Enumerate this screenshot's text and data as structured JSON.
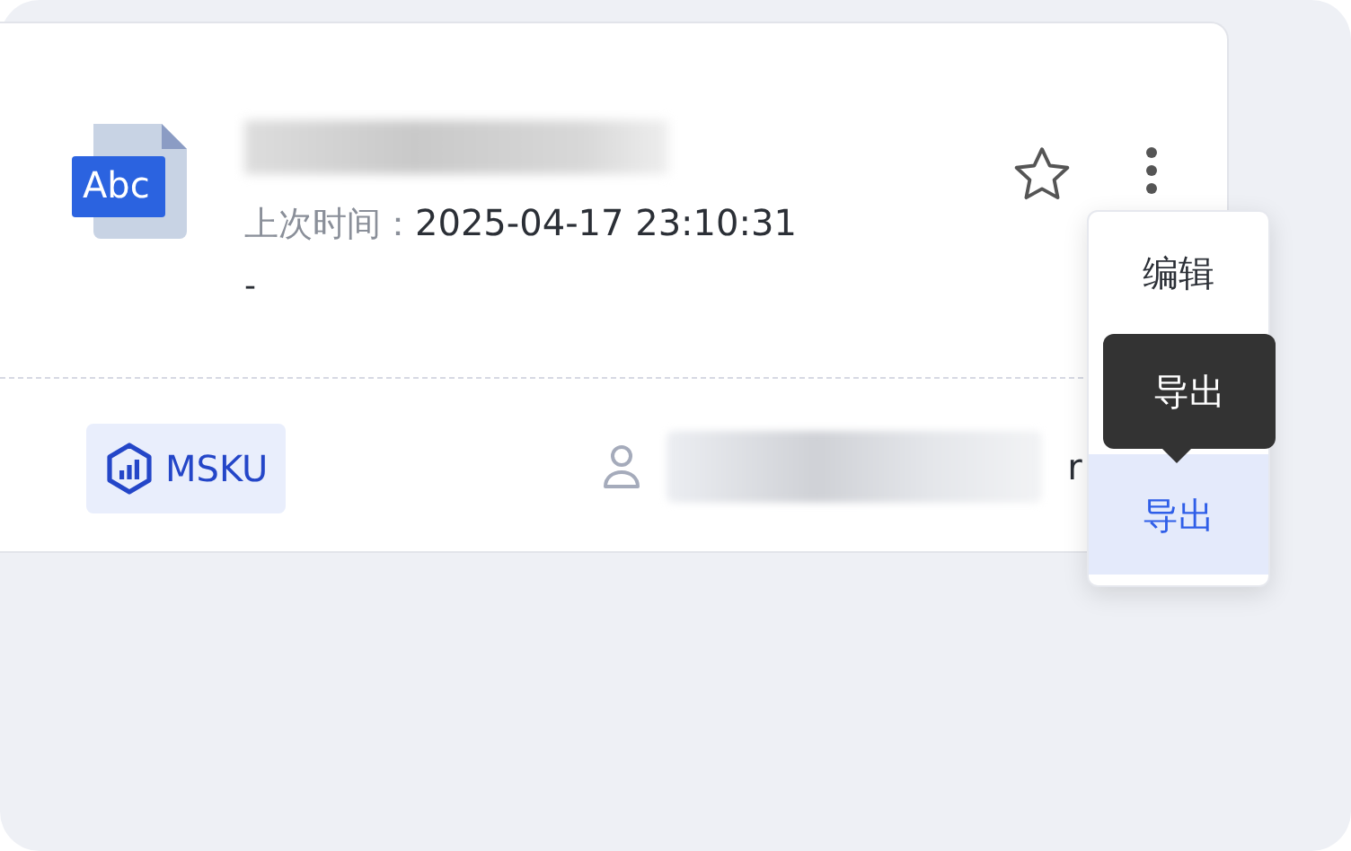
{
  "card": {
    "file_icon_label": "Abc",
    "title_redacted": true,
    "last_time_label": "上次时间：",
    "last_time": "2025-04-17 23:10:31",
    "note": "-",
    "starred": false,
    "tag": {
      "label": "MSKU"
    },
    "owner": {
      "redacted": true,
      "visible_tail": "r"
    }
  },
  "menu": {
    "items": [
      {
        "kind": "item",
        "label": "编辑",
        "selected": false
      },
      {
        "kind": "covered"
      },
      {
        "kind": "item",
        "label": "导出",
        "selected": true
      }
    ]
  },
  "tooltip": {
    "text": "导出"
  }
}
